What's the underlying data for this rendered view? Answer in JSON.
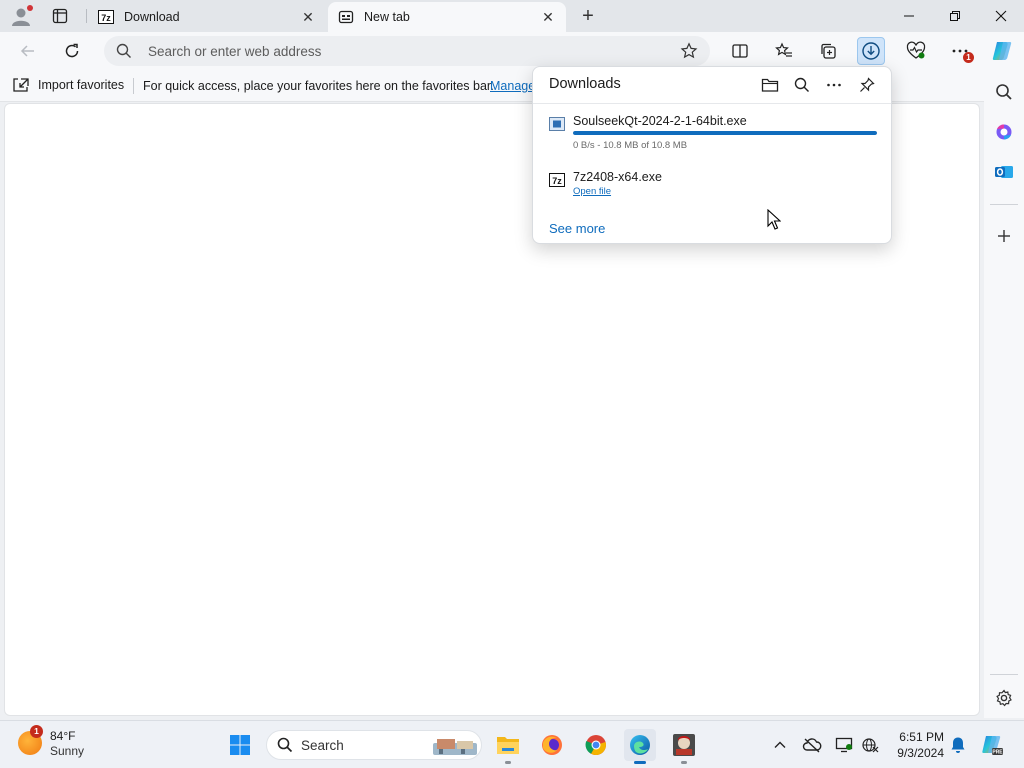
{
  "tabs": [
    {
      "title": "Download",
      "favicon": "7z-icon",
      "active": false
    },
    {
      "title": "New tab",
      "favicon": "newtab-icon",
      "active": true
    }
  ],
  "address_bar": {
    "placeholder": "Search or enter web address",
    "value": ""
  },
  "favorites_bar": {
    "import_label": "Import favorites",
    "message": "For quick access, place your favorites here on the favorites bar.",
    "manage_link": "Manage favorites now"
  },
  "downloads_panel": {
    "title": "Downloads",
    "items": [
      {
        "filename": "SoulseekQt-2024-2-1-64bit.exe",
        "status": "0 B/s - 10.8 MB of 10.8 MB",
        "progress": 1.0,
        "icon": "installer-icon"
      },
      {
        "filename": "7z2408-x64.exe",
        "action": "Open file",
        "icon": "7z-icon"
      }
    ],
    "see_more": "See more"
  },
  "toolbar": {
    "downloads_badge": "1"
  },
  "taskbar": {
    "weather": {
      "temp": "84°F",
      "condition": "Sunny",
      "badge": "1"
    },
    "search_label": "Search",
    "clock": {
      "time": "6:51 PM",
      "date": "9/3/2024"
    }
  },
  "colors": {
    "accent": "#0f6cbd",
    "badge": "#c42b1c",
    "page_bg": "#ffffff"
  }
}
